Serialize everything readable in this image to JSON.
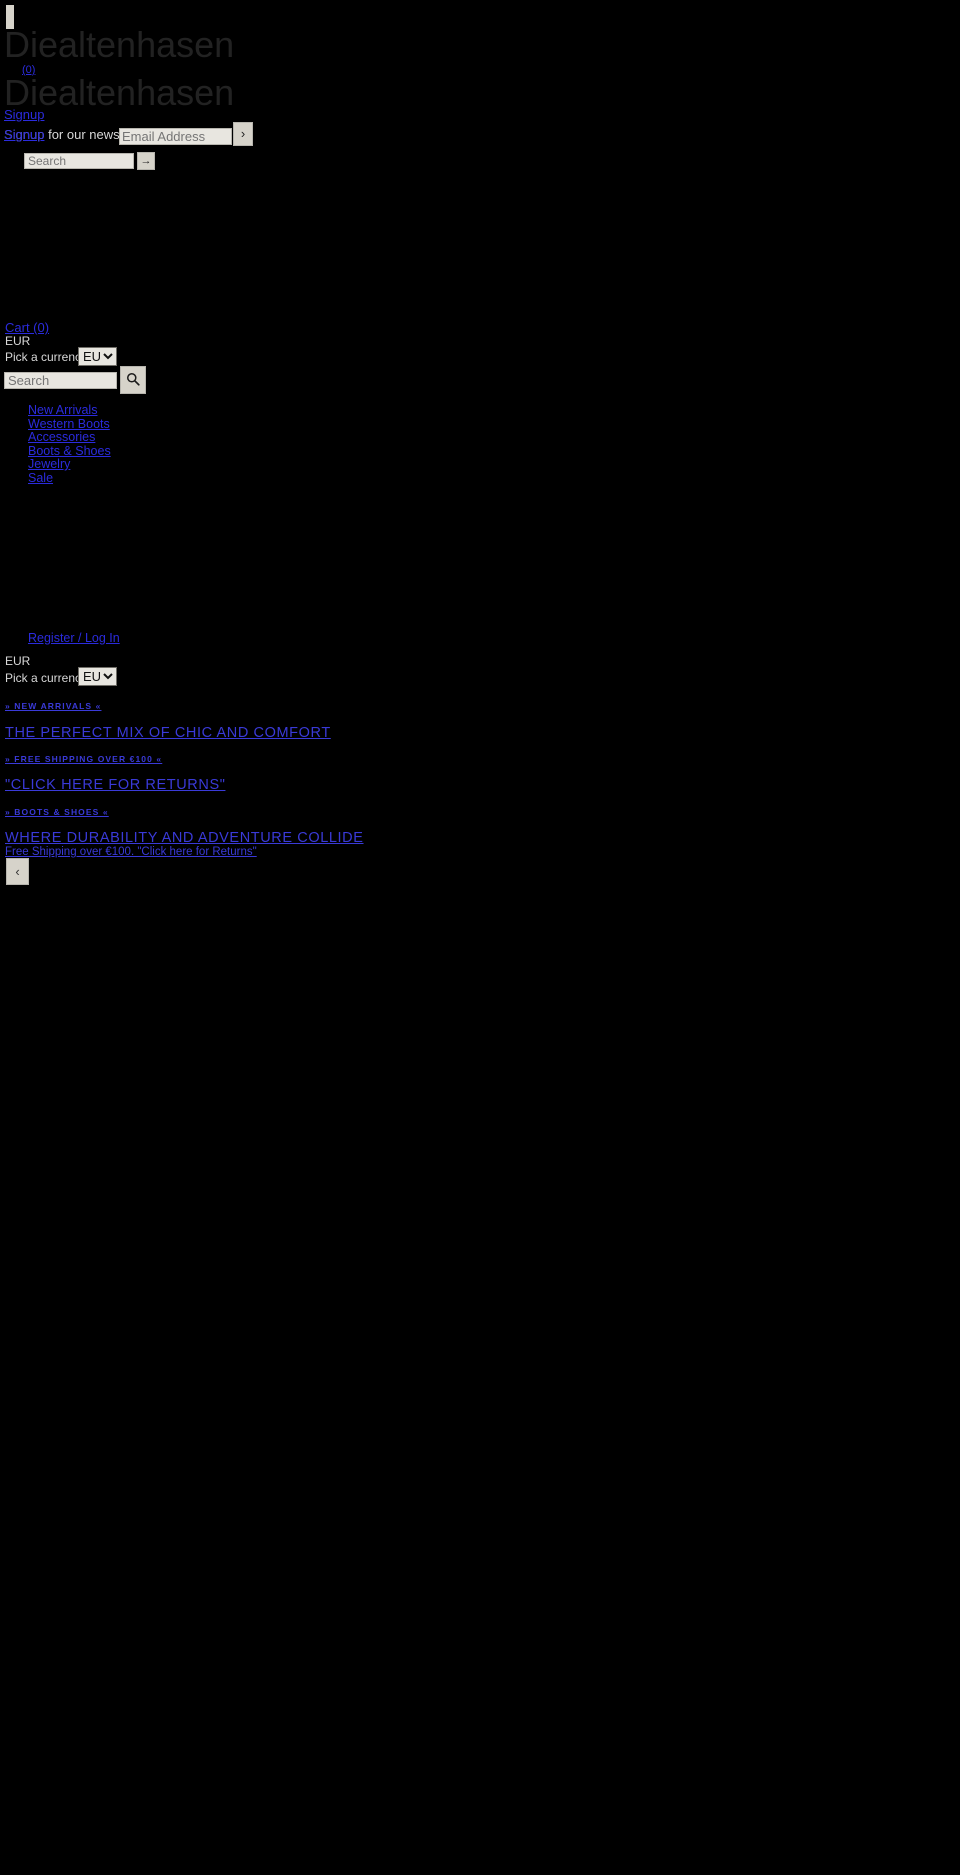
{
  "site": {
    "brand": "Diealtenhasen",
    "brand_repeat": "Diealtenhasen",
    "cart_badge": "(0)"
  },
  "newsletter": {
    "signup_link": "Signup",
    "prompt": "Signup for our newsletter",
    "email_placeholder": "Email Address",
    "submit_icon": "›",
    "submit_name": "newsletter-submit"
  },
  "top_search": {
    "placeholder": "Search",
    "submit_icon": "→"
  },
  "cart": {
    "label": "Cart (0)"
  },
  "currency": {
    "code": "EUR",
    "label": "Pick a currency",
    "selected": "EUR",
    "options": [
      "EUR"
    ]
  },
  "currency_secondary": {
    "code": "EUR",
    "label": "Pick a currency",
    "selected": "EUR",
    "options": [
      "EUR"
    ]
  },
  "search": {
    "placeholder": "Search",
    "icon": "search-icon"
  },
  "nav": {
    "items": [
      {
        "label": "New Arrivals"
      },
      {
        "label": "Western Boots"
      },
      {
        "label": "Accessories"
      },
      {
        "label": "Boots & Shoes"
      },
      {
        "label": "Jewelry"
      },
      {
        "label": "Sale"
      }
    ]
  },
  "account": {
    "label": "Register / Log In"
  },
  "slider": {
    "prev_icon": "‹",
    "slides": [
      {
        "eyebrow": "» NEW ARRIVALS «",
        "heading": "THE PERFECT MIX OF CHIC AND COMFORT"
      },
      {
        "eyebrow": "» FREE SHIPPING OVER €100 «",
        "heading": "\"CLICK HERE FOR RETURNS\""
      },
      {
        "eyebrow": "» BOOTS & SHOES «",
        "heading": "WHERE DURABILITY AND ADVENTURE COLLIDE",
        "subheading": "Free Shipping over €100. \"Click here for Returns\""
      }
    ]
  }
}
